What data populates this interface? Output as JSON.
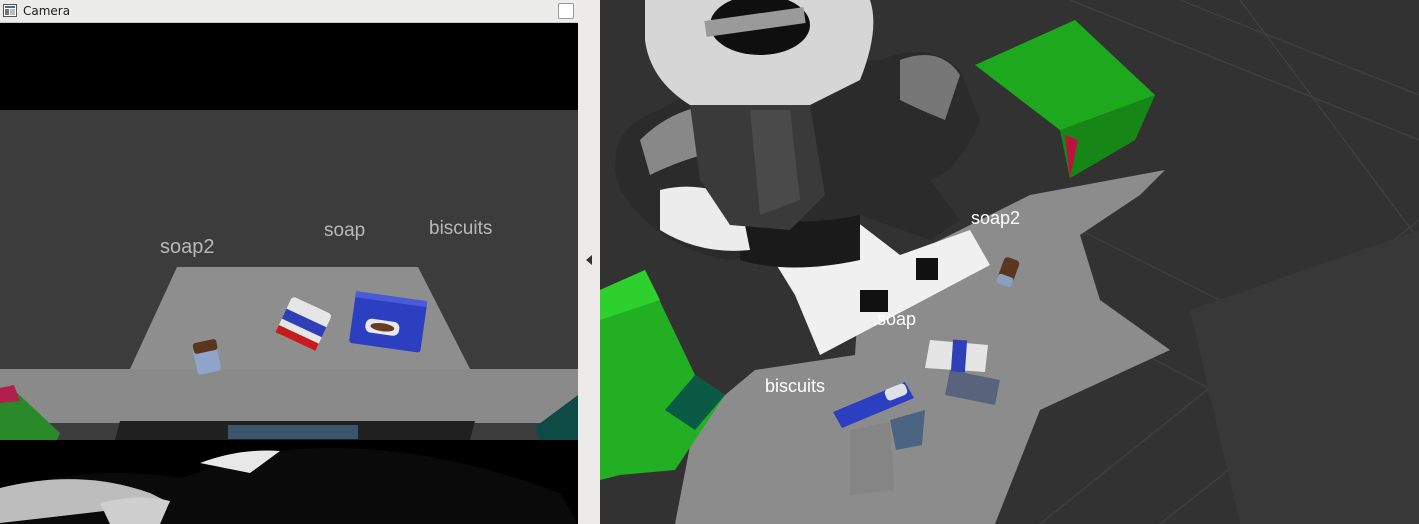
{
  "camera_window": {
    "title": "Camera",
    "labels": {
      "soap2": "soap2",
      "soap": "soap",
      "biscuits": "biscuits"
    }
  },
  "scene_view": {
    "labels": {
      "soap2": "soap2",
      "soap": "soap",
      "biscuits": "biscuits"
    }
  },
  "icons": {
    "window": "camera-window-icon",
    "maximize": "maximize-button",
    "collapse": "collapse-arrow-icon"
  },
  "colors": {
    "table": "#8f8f8f",
    "floor": "#383838",
    "dropbox_green": "#1fa01f",
    "soap2_box": "#2c3fc0",
    "titlebar": "#ececea"
  }
}
